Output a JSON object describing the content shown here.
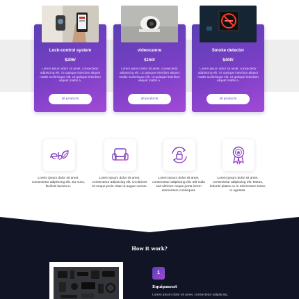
{
  "products": [
    {
      "title": "Lock-control system",
      "price": "$206/",
      "image": "smartphone-lock-photo",
      "desc": "Lorem ipsum dolor sit amet, consectetur adipiscing elit. Ut quisque interdum aliquet mattis scelerisque elit. Ut quisque interdum aliquet mattis a.",
      "button": "all products"
    },
    {
      "title": "videocamre",
      "price": "$150/",
      "image": "security-camera-photo",
      "desc": "Lorem ipsum dolor sit amet, consectetur adipiscing elit. Ut quisque interdum aliquet mattis scelerisque elit. Ut quisque interdum aliquet mattis a.",
      "button": "all products"
    },
    {
      "title": "Smoke detector",
      "price": "$400/",
      "image": "no-smoking-sign-photo",
      "desc": "Lorem ipsum dolor sit amet, consectetur adipiscing elit. Ut quisque interdum aliquet mattis scelerisque elit. Ut quisque interdum aliquet mattis a.",
      "button": "all products"
    }
  ],
  "features": [
    {
      "icon": "eco-leaf-icon",
      "text": "Lorem ipsum dolor sit amet, consectetur adipiscing elit. Eu nunc, facilisis lacinia in."
    },
    {
      "icon": "armchair-icon",
      "text": "Lorem ipsum dolor sit amet, consectetur adipiscing elit. Ut ultrices sit neque proin vitae ut augue cursus."
    },
    {
      "icon": "lock-refresh-icon",
      "text": "Lorem ipsum dolor sit amet, consectetur adipiscing elit. Elit nulla sed ultricies neque porta lorem elementum consequat."
    },
    {
      "icon": "award-ribbon-icon",
      "text": "Lorem ipsum dolor sit amet, consectetur adipiscing elit. Metus, lobortis platea eu in elementum tortor, in egestas."
    }
  ],
  "how": {
    "title": "How it work?",
    "step_number": "1",
    "step_title": "Equipment",
    "step_desc": "Lorem ipsum dolor sit amet, consectetur adipiscing"
  },
  "colors": {
    "accent_start": "#5b3fb4",
    "accent_end": "#a14ad6",
    "dark_bg": "#111425",
    "band_bg": "#eeeeee"
  }
}
